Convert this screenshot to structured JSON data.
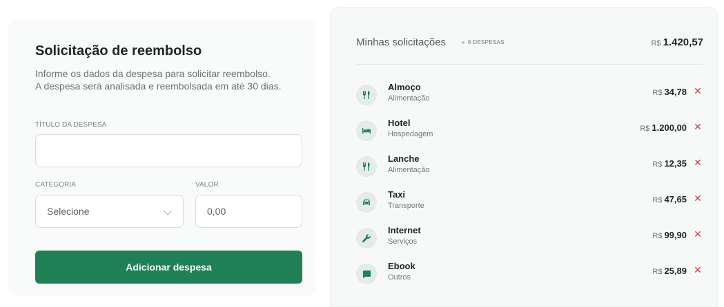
{
  "form": {
    "title": "Solicitação de reembolso",
    "description_line1": "Informe os dados da despesa para solicitar reembolso.",
    "description_line2": "A despesa será analisada e reembolsada em até 30 dias.",
    "title_label": "TÍTULO DA DESPESA",
    "title_value": "",
    "category_label": "CATEGORIA",
    "category_value": "Selecione",
    "amount_label": "VALOR",
    "amount_value": "0,00",
    "submit_label": "Adicionar despesa"
  },
  "list": {
    "title": "Minhas solicitações",
    "count": "6 DESPESAS",
    "currency": "R$",
    "total": "1.420,57",
    "remove_glyph": "✕",
    "items": [
      {
        "title": "Almoço",
        "category": "Alimentação",
        "currency": "R$",
        "value": "34,78",
        "icon": "fork-knife-icon"
      },
      {
        "title": "Hotel",
        "category": "Hospedagem",
        "currency": "R$",
        "value": "1.200,00",
        "icon": "bed-icon"
      },
      {
        "title": "Lanche",
        "category": "Alimentação",
        "currency": "R$",
        "value": "12,35",
        "icon": "fork-knife-icon"
      },
      {
        "title": "Taxi",
        "category": "Transporte",
        "currency": "R$",
        "value": "47,65",
        "icon": "car-icon"
      },
      {
        "title": "Internet",
        "category": "Serviços",
        "currency": "R$",
        "value": "99,90",
        "icon": "wrench-icon"
      },
      {
        "title": "Ebook",
        "category": "Outros",
        "currency": "R$",
        "value": "25,89",
        "icon": "message-icon"
      }
    ]
  },
  "colors": {
    "accent": "#1f8055",
    "remove": "#d83a3a",
    "icon_bg": "#e4ebe8"
  }
}
